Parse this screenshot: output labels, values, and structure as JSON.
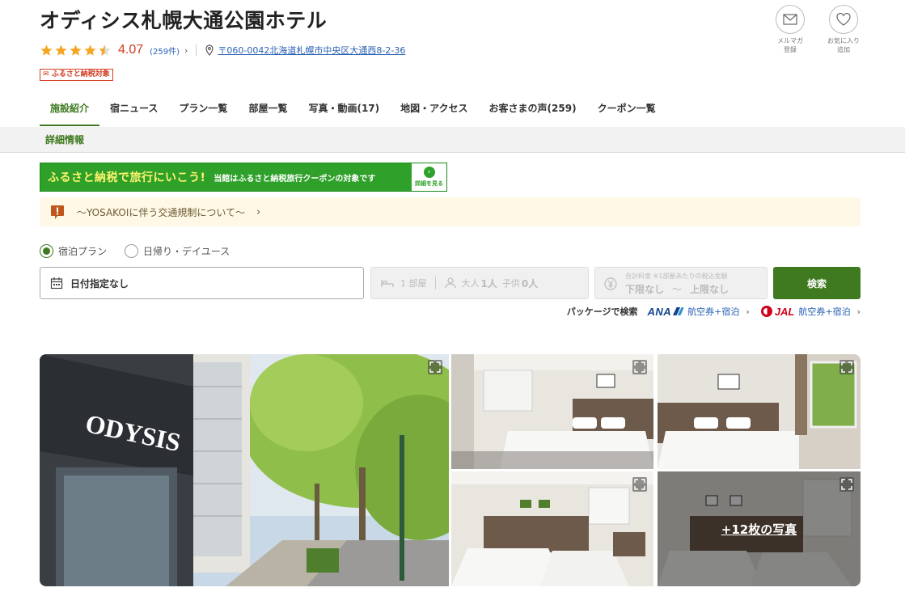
{
  "hotel": {
    "name": "オディシス札幌大通公園ホテル",
    "rating": 4.07,
    "score_text": "4.07",
    "review_count_text": "(259件)",
    "address": "〒060-0042北海道札幌市中央区大通西8-2-36",
    "furusato_badge": "ふるさと納税対象"
  },
  "top_actions": {
    "mail_label": "メルマガ\n登録",
    "fav_label": "お気に入り\n追加"
  },
  "tabs": [
    {
      "label": "施設紹介",
      "active": true
    },
    {
      "label": "宿ニュース",
      "active": false
    },
    {
      "label": "プラン一覧",
      "active": false
    },
    {
      "label": "部屋一覧",
      "active": false
    },
    {
      "label": "写真・動画(17)",
      "active": false
    },
    {
      "label": "地図・アクセス",
      "active": false
    },
    {
      "label": "お客さまの声(259)",
      "active": false
    },
    {
      "label": "クーポン一覧",
      "active": false
    }
  ],
  "subnav": {
    "item": "詳細情報"
  },
  "banner": {
    "main": "ふるさと納税で旅行にいこう!",
    "sub": "当館はふるさと納税旅行クーポンの対象です",
    "button": "詳細を見る"
  },
  "notice": {
    "text": "〜YOSAKOIに伴う交通規制について〜"
  },
  "search": {
    "radio_stay": "宿泊プラン",
    "radio_day": "日帰り・デイユース",
    "date_text": "日付指定なし",
    "rooms": "1 部屋",
    "adults_label": "大人",
    "adults_value": "1人",
    "children_label": "子供",
    "children_value": "0人",
    "price_caption": "合計料金 ※1部屋あたりの税込金額",
    "price_min": "下限なし",
    "price_tilde": "〜",
    "price_max": "上限なし",
    "button": "検索"
  },
  "package": {
    "label": "パッケージで検索",
    "ana_logo": "ANA",
    "ana_link": "航空券+宿泊",
    "jal_logo": "JAL",
    "jal_link": "航空券+宿泊"
  },
  "gallery": {
    "more_label": "+12枚の写真"
  },
  "colors": {
    "accent_green": "#3f7a20",
    "score_red": "#d43b21",
    "link_blue": "#2a61b5",
    "star_gold": "#f5a623"
  },
  "icons": [
    "star-icon",
    "pin-icon",
    "mail-icon",
    "heart-icon",
    "alert-icon",
    "calendar-icon",
    "bed-icon",
    "person-icon",
    "yen-icon",
    "expand-icon"
  ]
}
